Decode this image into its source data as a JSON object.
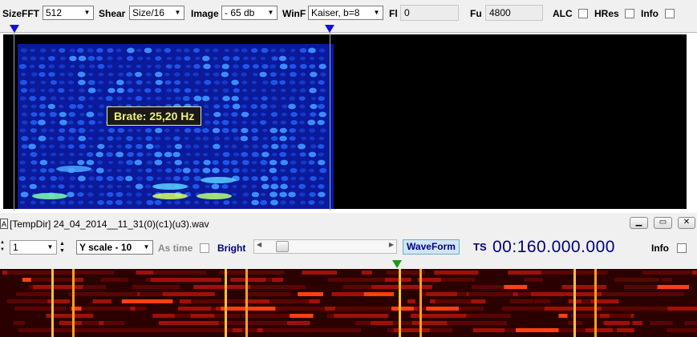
{
  "toolbar": {
    "size_fft_label": "SizeFFT",
    "size_fft_value": "512",
    "shear_label": "Shear",
    "shear_value": "Size/16",
    "image_label": "Image",
    "image_value": "- 65 db",
    "winf_label": "WinF",
    "winf_value": "Kaiser, b=8",
    "fl_label": "Fl",
    "fl_value": "0",
    "fu_label": "Fu",
    "fu_value": "4800",
    "alc_label": "ALC",
    "alc_checked": false,
    "hres_label": "HRes",
    "hres_checked": false,
    "info_label": "Info",
    "info_checked": false
  },
  "spectrogram": {
    "tooltip": "Brate: 25,20 Hz",
    "marker_color": "#1010e0"
  },
  "wave_window": {
    "title": "[TempDir] 24_04_2014__11_31(0)(c1)(u3).wav",
    "window_buttons": [
      "minimize",
      "maximize",
      "close"
    ],
    "channel_value": "1",
    "yscale_value": "Y scale - 10",
    "as_time_label": "As time",
    "bright_label": "Bright",
    "bright_checked": false,
    "waveform_button": "WaveForm",
    "ts_label": "TS",
    "ts_value": "00:160.000.000",
    "info_label": "Info",
    "info_checked": false,
    "position_marker_color": "#1a9a1a"
  }
}
